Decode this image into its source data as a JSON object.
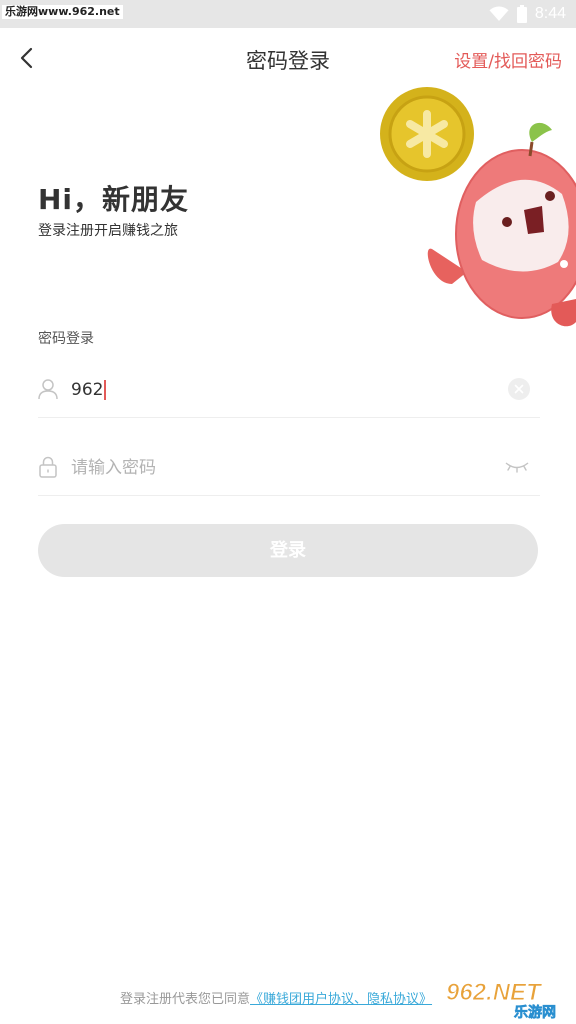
{
  "status_bar": {
    "watermark": "乐游网www.962.net",
    "time": "8:44",
    "wifi_icon": "wifi-icon",
    "battery_icon": "battery-icon"
  },
  "nav": {
    "back_icon": "chevron-left-icon",
    "title": "密码登录",
    "right_link": "设置/找回密码"
  },
  "hero": {
    "greeting": "Hi，新朋友",
    "subtitle": "登录注册开启赚钱之旅",
    "mascot": "peach-mascot-with-coin"
  },
  "form": {
    "section_label": "密码登录",
    "username": {
      "icon": "user-icon",
      "value": "962",
      "clear_icon": "clear-icon"
    },
    "password": {
      "icon": "lock-icon",
      "placeholder": "请输入密码",
      "toggle_icon": "eye-closed-icon"
    },
    "submit_label": "登录"
  },
  "footer": {
    "agreement_prefix": "登录注册代表您已同意",
    "agreement_link": "《赚钱团用户协议、隐私协议》",
    "watermark": "962.NET 乐游网"
  },
  "colors": {
    "accent": "#e35a58",
    "link": "#3aa9d9",
    "button_disabled": "#e5e5e5",
    "status_bar": "#e6e6e6"
  }
}
